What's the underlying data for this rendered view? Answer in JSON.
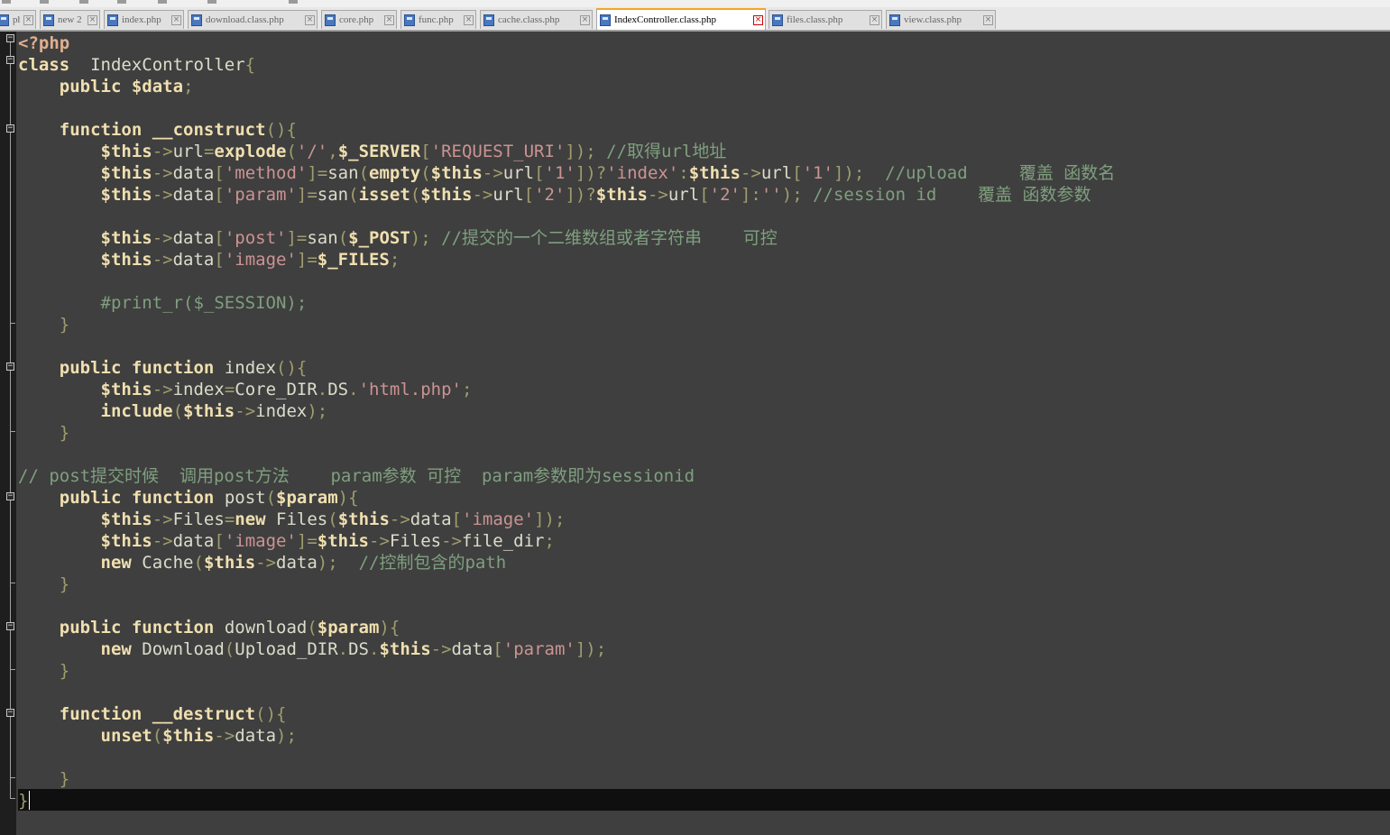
{
  "tabs": [
    {
      "label": "php",
      "active": false
    },
    {
      "label": "new 2",
      "active": false
    },
    {
      "label": "index.php",
      "active": false
    },
    {
      "label": "download.class.php",
      "active": false
    },
    {
      "label": "core.php",
      "active": false
    },
    {
      "label": "func.php",
      "active": false
    },
    {
      "label": "cache.class.php",
      "active": false
    },
    {
      "label": "IndexController.class.php",
      "active": true
    },
    {
      "label": "files.class.php",
      "active": false
    },
    {
      "label": "view.class.php",
      "active": false
    }
  ],
  "code_lines": [
    [
      [
        "tg",
        "<?php"
      ]
    ],
    [
      [
        "kw",
        "class"
      ],
      [
        "",
        "  IndexController"
      ],
      [
        "op",
        "{"
      ]
    ],
    [
      [
        "",
        "    "
      ],
      [
        "kw",
        "public"
      ],
      [
        "",
        " "
      ],
      [
        "vr",
        "$data"
      ],
      [
        "op",
        ";"
      ]
    ],
    [],
    [
      [
        "",
        "    "
      ],
      [
        "kw",
        "function"
      ],
      [
        "",
        " "
      ],
      [
        "fn",
        "__construct"
      ],
      [
        "op",
        "(){"
      ]
    ],
    [
      [
        "",
        "        "
      ],
      [
        "vr",
        "$this"
      ],
      [
        "op",
        "->"
      ],
      [
        "",
        "url"
      ],
      [
        "op",
        "="
      ],
      [
        "fn",
        "explode"
      ],
      [
        "op",
        "("
      ],
      [
        "st",
        "'/'"
      ],
      [
        "op",
        ","
      ],
      [
        "vr",
        "$_SERVER"
      ],
      [
        "op",
        "["
      ],
      [
        "st",
        "'REQUEST_URI'"
      ],
      [
        "op",
        "]);"
      ],
      [
        "",
        " "
      ],
      [
        "cm",
        "//取得url地址"
      ]
    ],
    [
      [
        "",
        "        "
      ],
      [
        "vr",
        "$this"
      ],
      [
        "op",
        "->"
      ],
      [
        "",
        "data"
      ],
      [
        "op",
        "["
      ],
      [
        "st",
        "'method'"
      ],
      [
        "op",
        "]="
      ],
      [
        "",
        "san"
      ],
      [
        "op",
        "("
      ],
      [
        "fn",
        "empty"
      ],
      [
        "op",
        "("
      ],
      [
        "vr",
        "$this"
      ],
      [
        "op",
        "->"
      ],
      [
        "",
        "url"
      ],
      [
        "op",
        "["
      ],
      [
        "st",
        "'1'"
      ],
      [
        "op",
        "])?"
      ],
      [
        "st",
        "'index'"
      ],
      [
        "op",
        ":"
      ],
      [
        "vr",
        "$this"
      ],
      [
        "op",
        "->"
      ],
      [
        "",
        "url"
      ],
      [
        "op",
        "["
      ],
      [
        "st",
        "'1'"
      ],
      [
        "op",
        "]);"
      ],
      [
        "",
        "  "
      ],
      [
        "cm",
        "//upload     覆盖 函数名"
      ]
    ],
    [
      [
        "",
        "        "
      ],
      [
        "vr",
        "$this"
      ],
      [
        "op",
        "->"
      ],
      [
        "",
        "data"
      ],
      [
        "op",
        "["
      ],
      [
        "st",
        "'param'"
      ],
      [
        "op",
        "]="
      ],
      [
        "",
        "san"
      ],
      [
        "op",
        "("
      ],
      [
        "fn",
        "isset"
      ],
      [
        "op",
        "("
      ],
      [
        "vr",
        "$this"
      ],
      [
        "op",
        "->"
      ],
      [
        "",
        "url"
      ],
      [
        "op",
        "["
      ],
      [
        "st",
        "'2'"
      ],
      [
        "op",
        "])?"
      ],
      [
        "vr",
        "$this"
      ],
      [
        "op",
        "->"
      ],
      [
        "",
        "url"
      ],
      [
        "op",
        "["
      ],
      [
        "st",
        "'2'"
      ],
      [
        "op",
        "]:"
      ],
      [
        "st",
        "''"
      ],
      [
        "op",
        ");"
      ],
      [
        "",
        " "
      ],
      [
        "cm",
        "//session id    覆盖 函数参数"
      ]
    ],
    [],
    [
      [
        "",
        "        "
      ],
      [
        "vr",
        "$this"
      ],
      [
        "op",
        "->"
      ],
      [
        "",
        "data"
      ],
      [
        "op",
        "["
      ],
      [
        "st",
        "'post'"
      ],
      [
        "op",
        "]="
      ],
      [
        "",
        "san"
      ],
      [
        "op",
        "("
      ],
      [
        "vr",
        "$_POST"
      ],
      [
        "op",
        ");"
      ],
      [
        "",
        " "
      ],
      [
        "cm",
        "//提交的一个二维数组或者字符串    可控"
      ]
    ],
    [
      [
        "",
        "        "
      ],
      [
        "vr",
        "$this"
      ],
      [
        "op",
        "->"
      ],
      [
        "",
        "data"
      ],
      [
        "op",
        "["
      ],
      [
        "st",
        "'image'"
      ],
      [
        "op",
        "]="
      ],
      [
        "vr",
        "$_FILES"
      ],
      [
        "op",
        ";"
      ]
    ],
    [],
    [
      [
        "",
        "        "
      ],
      [
        "cm",
        "#print_r($_SESSION);"
      ]
    ],
    [
      [
        "",
        "    "
      ],
      [
        "op",
        "}"
      ]
    ],
    [],
    [
      [
        "",
        "    "
      ],
      [
        "kw",
        "public"
      ],
      [
        "",
        " "
      ],
      [
        "kw",
        "function"
      ],
      [
        "",
        " index"
      ],
      [
        "op",
        "(){"
      ]
    ],
    [
      [
        "",
        "        "
      ],
      [
        "vr",
        "$this"
      ],
      [
        "op",
        "->"
      ],
      [
        "",
        "index"
      ],
      [
        "op",
        "="
      ],
      [
        "",
        "Core_DIR"
      ],
      [
        "op",
        "."
      ],
      [
        "",
        "DS"
      ],
      [
        "op",
        "."
      ],
      [
        "st",
        "'html.php'"
      ],
      [
        "op",
        ";"
      ]
    ],
    [
      [
        "",
        "        "
      ],
      [
        "fn",
        "include"
      ],
      [
        "op",
        "("
      ],
      [
        "vr",
        "$this"
      ],
      [
        "op",
        "->"
      ],
      [
        "",
        "index"
      ],
      [
        "op",
        ");"
      ]
    ],
    [
      [
        "",
        "    "
      ],
      [
        "op",
        "}"
      ]
    ],
    [],
    [
      [
        "cm",
        "// post提交时候  调用post方法    param参数 可控  param参数即为sessionid"
      ]
    ],
    [
      [
        "",
        "    "
      ],
      [
        "kw",
        "public"
      ],
      [
        "",
        " "
      ],
      [
        "kw",
        "function"
      ],
      [
        "",
        " post"
      ],
      [
        "op",
        "("
      ],
      [
        "vr",
        "$param"
      ],
      [
        "op",
        "){"
      ]
    ],
    [
      [
        "",
        "        "
      ],
      [
        "vr",
        "$this"
      ],
      [
        "op",
        "->"
      ],
      [
        "",
        "Files"
      ],
      [
        "op",
        "="
      ],
      [
        "kw",
        "new"
      ],
      [
        "",
        " Files"
      ],
      [
        "op",
        "("
      ],
      [
        "vr",
        "$this"
      ],
      [
        "op",
        "->"
      ],
      [
        "",
        "data"
      ],
      [
        "op",
        "["
      ],
      [
        "st",
        "'image'"
      ],
      [
        "op",
        "]);"
      ]
    ],
    [
      [
        "",
        "        "
      ],
      [
        "vr",
        "$this"
      ],
      [
        "op",
        "->"
      ],
      [
        "",
        "data"
      ],
      [
        "op",
        "["
      ],
      [
        "st",
        "'image'"
      ],
      [
        "op",
        "]="
      ],
      [
        "vr",
        "$this"
      ],
      [
        "op",
        "->"
      ],
      [
        "",
        "Files"
      ],
      [
        "op",
        "->"
      ],
      [
        "",
        "file_dir"
      ],
      [
        "op",
        ";"
      ]
    ],
    [
      [
        "",
        "        "
      ],
      [
        "kw",
        "new"
      ],
      [
        "",
        " Cache"
      ],
      [
        "op",
        "("
      ],
      [
        "vr",
        "$this"
      ],
      [
        "op",
        "->"
      ],
      [
        "",
        "data"
      ],
      [
        "op",
        ");"
      ],
      [
        "",
        "  "
      ],
      [
        "cm",
        "//控制包含的path"
      ]
    ],
    [
      [
        "",
        "    "
      ],
      [
        "op",
        "}"
      ]
    ],
    [],
    [
      [
        "",
        "    "
      ],
      [
        "kw",
        "public"
      ],
      [
        "",
        " "
      ],
      [
        "kw",
        "function"
      ],
      [
        "",
        " download"
      ],
      [
        "op",
        "("
      ],
      [
        "vr",
        "$param"
      ],
      [
        "op",
        "){"
      ]
    ],
    [
      [
        "",
        "        "
      ],
      [
        "kw",
        "new"
      ],
      [
        "",
        " Download"
      ],
      [
        "op",
        "("
      ],
      [
        "",
        "Upload_DIR"
      ],
      [
        "op",
        "."
      ],
      [
        "",
        "DS"
      ],
      [
        "op",
        "."
      ],
      [
        "vr",
        "$this"
      ],
      [
        "op",
        "->"
      ],
      [
        "",
        "data"
      ],
      [
        "op",
        "["
      ],
      [
        "st",
        "'param'"
      ],
      [
        "op",
        "]);"
      ]
    ],
    [
      [
        "",
        "    "
      ],
      [
        "op",
        "}"
      ]
    ],
    [],
    [
      [
        "",
        "    "
      ],
      [
        "kw",
        "function"
      ],
      [
        "",
        " "
      ],
      [
        "fn",
        "__destruct"
      ],
      [
        "op",
        "(){"
      ]
    ],
    [
      [
        "",
        "        "
      ],
      [
        "fn",
        "unset"
      ],
      [
        "op",
        "("
      ],
      [
        "vr",
        "$this"
      ],
      [
        "op",
        "->"
      ],
      [
        "",
        "data"
      ],
      [
        "op",
        ");"
      ]
    ],
    [],
    [
      [
        "",
        "    "
      ],
      [
        "op",
        "}"
      ]
    ],
    [
      [
        "op",
        "}"
      ]
    ]
  ]
}
